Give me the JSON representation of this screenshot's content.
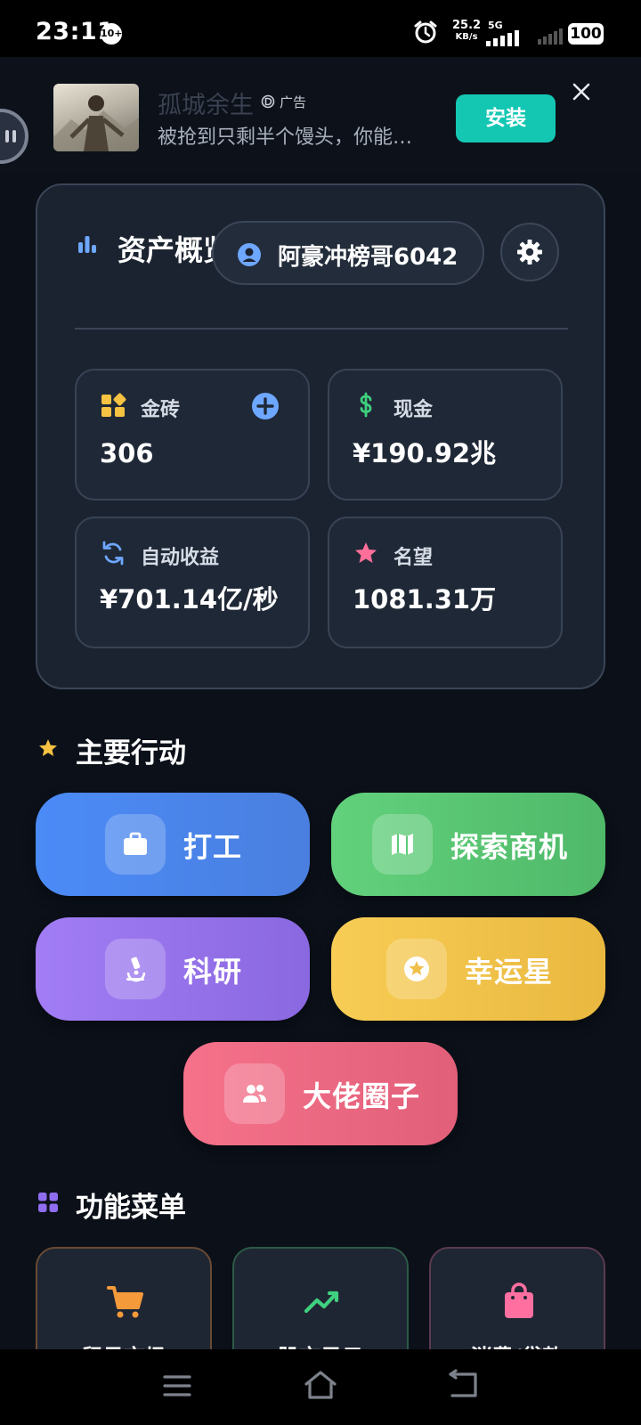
{
  "status_bar": {
    "time": "23:11",
    "notification_count": "10+",
    "net_speed_value": "25.2",
    "net_speed_unit": "KB/s",
    "network_type": "5G",
    "battery": "100"
  },
  "ad": {
    "title": "孤城余生",
    "tag": "广告",
    "description": "被抢到只剩半个馒头，你能…",
    "install_label": "安装"
  },
  "asset_card": {
    "title": "资产概览",
    "username": "阿豪冲榜哥6042",
    "stats": [
      {
        "label": "金砖",
        "value": "306",
        "icon": "gold-brick-icon",
        "color": "#f5c242"
      },
      {
        "label": "现金",
        "value": "¥190.92兆",
        "icon": "dollar-icon",
        "color": "#3fd07f"
      },
      {
        "label": "自动收益",
        "value": "¥701.14亿/秒",
        "icon": "refresh-icon",
        "color": "#6ea7ff"
      },
      {
        "label": "名望",
        "value": "1081.31万",
        "icon": "star-icon",
        "color": "#ff6f9a"
      }
    ]
  },
  "main_actions": {
    "title": "主要行动",
    "buttons": [
      {
        "label": "打工",
        "icon": "briefcase-icon",
        "color": "#4a86f5"
      },
      {
        "label": "探索商机",
        "icon": "map-icon",
        "color": "#5ccb78"
      },
      {
        "label": "科研",
        "icon": "microscope-icon",
        "color": "#9a72ef"
      },
      {
        "label": "幸运星",
        "icon": "star-badge-icon",
        "color": "#f5c648"
      },
      {
        "label": "大佬圈子",
        "icon": "people-icon",
        "color": "#f06a84"
      }
    ]
  },
  "function_menu": {
    "title": "功能菜单",
    "items": [
      {
        "label": "贸易市场",
        "icon": "cart-icon",
        "color": "#f59a3a"
      },
      {
        "label": "股市风云",
        "icon": "trend-icon",
        "color": "#3fd07f"
      },
      {
        "label": "消费/贷款",
        "icon": "shopping-bag-icon",
        "color": "#ff6fa0"
      }
    ]
  }
}
